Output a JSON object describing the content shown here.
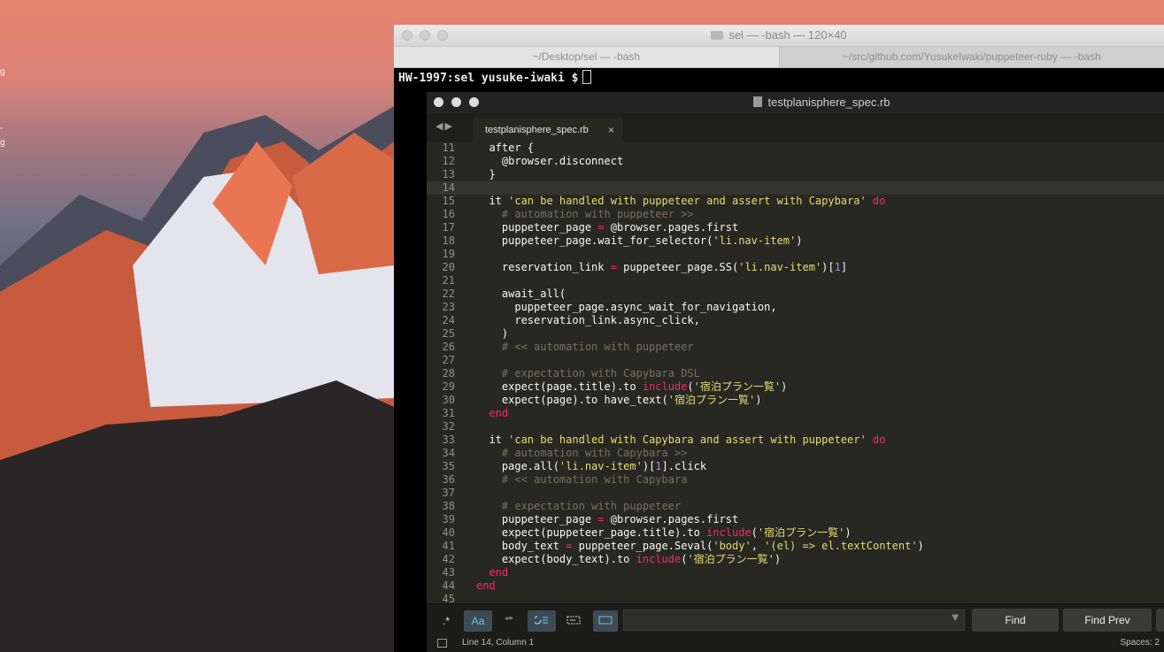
{
  "desktop": {
    "labels": [
      "g",
      "-",
      "g"
    ]
  },
  "terminal": {
    "title": "sel — -bash — 120×40",
    "tabs": [
      "~/Desktop/sel — -bash",
      "~/src/github.com/YusukeIwaki/puppeteer-ruby — -bash"
    ],
    "prompt": "HW-1997:sel yusuke-iwaki $"
  },
  "editor": {
    "title": "testplanisphere_spec.rb",
    "tab_label": "testplanisphere_spec.rb",
    "tab_close": "×",
    "current_line": 14,
    "lines": [
      {
        "n": 11,
        "t": [
          {
            "c": "#f8f8f2",
            "s": "  after {"
          }
        ]
      },
      {
        "n": 12,
        "t": [
          {
            "c": "#f8f8f2",
            "s": "    @browser.disconnect"
          }
        ]
      },
      {
        "n": 13,
        "t": [
          {
            "c": "#f8f8f2",
            "s": "  }"
          }
        ]
      },
      {
        "n": 14,
        "t": []
      },
      {
        "n": 15,
        "t": [
          {
            "c": "#f8f8f2",
            "s": "  it "
          },
          {
            "c": "#e6db74",
            "s": "'can be handled with puppeteer and assert with Capybara'"
          },
          {
            "c": "#f92672",
            "s": " do"
          }
        ]
      },
      {
        "n": 16,
        "t": [
          {
            "c": "#75715e",
            "s": "    # automation with puppeteer >>"
          }
        ]
      },
      {
        "n": 17,
        "t": [
          {
            "c": "#f8f8f2",
            "s": "    puppeteer_page "
          },
          {
            "c": "#f92672",
            "s": "="
          },
          {
            "c": "#f8f8f2",
            "s": " @browser.pages.first"
          }
        ]
      },
      {
        "n": 18,
        "t": [
          {
            "c": "#f8f8f2",
            "s": "    puppeteer_page.wait_for_selector("
          },
          {
            "c": "#e6db74",
            "s": "'li.nav-item'"
          },
          {
            "c": "#f8f8f2",
            "s": ")"
          }
        ]
      },
      {
        "n": 19,
        "t": []
      },
      {
        "n": 20,
        "t": [
          {
            "c": "#f8f8f2",
            "s": "    reservation_link "
          },
          {
            "c": "#f92672",
            "s": "="
          },
          {
            "c": "#f8f8f2",
            "s": " puppeteer_page.SS("
          },
          {
            "c": "#e6db74",
            "s": "'li.nav-item'"
          },
          {
            "c": "#f8f8f2",
            "s": ")["
          },
          {
            "c": "#ae81ff",
            "s": "1"
          },
          {
            "c": "#f8f8f2",
            "s": "]"
          }
        ]
      },
      {
        "n": 21,
        "t": []
      },
      {
        "n": 22,
        "t": [
          {
            "c": "#f8f8f2",
            "s": "    await_all("
          }
        ]
      },
      {
        "n": 23,
        "t": [
          {
            "c": "#f8f8f2",
            "s": "      puppeteer_page.async_wait_for_navigation,"
          }
        ]
      },
      {
        "n": 24,
        "t": [
          {
            "c": "#f8f8f2",
            "s": "      reservation_link.async_click,"
          }
        ]
      },
      {
        "n": 25,
        "t": [
          {
            "c": "#f8f8f2",
            "s": "    )"
          }
        ]
      },
      {
        "n": 26,
        "t": [
          {
            "c": "#75715e",
            "s": "    # << automation with puppeteer"
          }
        ]
      },
      {
        "n": 27,
        "t": []
      },
      {
        "n": 28,
        "t": [
          {
            "c": "#75715e",
            "s": "    # expectation with Capybara DSL"
          }
        ]
      },
      {
        "n": 29,
        "t": [
          {
            "c": "#f8f8f2",
            "s": "    expect(page.title).to "
          },
          {
            "c": "#f92672",
            "s": "include"
          },
          {
            "c": "#f8f8f2",
            "s": "("
          },
          {
            "c": "#e6db74",
            "s": "'宿泊プラン一覧'"
          },
          {
            "c": "#f8f8f2",
            "s": ")"
          }
        ]
      },
      {
        "n": 30,
        "t": [
          {
            "c": "#f8f8f2",
            "s": "    expect(page).to have_text("
          },
          {
            "c": "#e6db74",
            "s": "'宿泊プラン一覧'"
          },
          {
            "c": "#f8f8f2",
            "s": ")"
          }
        ]
      },
      {
        "n": 31,
        "t": [
          {
            "c": "#f92672",
            "s": "  end"
          }
        ]
      },
      {
        "n": 32,
        "t": []
      },
      {
        "n": 33,
        "t": [
          {
            "c": "#f8f8f2",
            "s": "  it "
          },
          {
            "c": "#e6db74",
            "s": "'can be handled with Capybara and assert with puppeteer'"
          },
          {
            "c": "#f92672",
            "s": " do"
          }
        ]
      },
      {
        "n": 34,
        "t": [
          {
            "c": "#75715e",
            "s": "    # automation with Capybara >>"
          }
        ]
      },
      {
        "n": 35,
        "t": [
          {
            "c": "#f8f8f2",
            "s": "    page.all("
          },
          {
            "c": "#e6db74",
            "s": "'li.nav-item'"
          },
          {
            "c": "#f8f8f2",
            "s": ")["
          },
          {
            "c": "#ae81ff",
            "s": "1"
          },
          {
            "c": "#f8f8f2",
            "s": "].click"
          }
        ]
      },
      {
        "n": 36,
        "t": [
          {
            "c": "#75715e",
            "s": "    # << automation with Capybara"
          }
        ]
      },
      {
        "n": 37,
        "t": []
      },
      {
        "n": 38,
        "t": [
          {
            "c": "#75715e",
            "s": "    # expectation with puppeteer"
          }
        ]
      },
      {
        "n": 39,
        "t": [
          {
            "c": "#f8f8f2",
            "s": "    puppeteer_page "
          },
          {
            "c": "#f92672",
            "s": "="
          },
          {
            "c": "#f8f8f2",
            "s": " @browser.pages.first"
          }
        ]
      },
      {
        "n": 40,
        "t": [
          {
            "c": "#f8f8f2",
            "s": "    expect(puppeteer_page.title).to "
          },
          {
            "c": "#f92672",
            "s": "include"
          },
          {
            "c": "#f8f8f2",
            "s": "("
          },
          {
            "c": "#e6db74",
            "s": "'宿泊プラン一覧'"
          },
          {
            "c": "#f8f8f2",
            "s": ")"
          }
        ]
      },
      {
        "n": 41,
        "t": [
          {
            "c": "#f8f8f2",
            "s": "    body_text "
          },
          {
            "c": "#f92672",
            "s": "="
          },
          {
            "c": "#f8f8f2",
            "s": " puppeteer_page.Seval("
          },
          {
            "c": "#e6db74",
            "s": "'body'"
          },
          {
            "c": "#f8f8f2",
            "s": ", "
          },
          {
            "c": "#e6db74",
            "s": "'(el) => el.textContent'"
          },
          {
            "c": "#f8f8f2",
            "s": ")"
          }
        ]
      },
      {
        "n": 42,
        "t": [
          {
            "c": "#f8f8f2",
            "s": "    expect(body_text).to "
          },
          {
            "c": "#f92672",
            "s": "include"
          },
          {
            "c": "#f8f8f2",
            "s": "("
          },
          {
            "c": "#e6db74",
            "s": "'宿泊プラン一覧'"
          },
          {
            "c": "#f8f8f2",
            "s": ")"
          }
        ]
      },
      {
        "n": 43,
        "t": [
          {
            "c": "#f92672",
            "s": "  end"
          }
        ]
      },
      {
        "n": 44,
        "t": [
          {
            "c": "#f92672",
            "s": "end"
          }
        ]
      },
      {
        "n": 45,
        "t": []
      }
    ]
  },
  "find_panel": {
    "regex_label": ".*",
    "case_label": "Aa",
    "word_label": "“”",
    "find_label": "Find",
    "find_prev_label": "Find Prev",
    "input_value": ""
  },
  "status": {
    "position": "Line 14, Column 1",
    "indent": "Spaces: 2"
  }
}
